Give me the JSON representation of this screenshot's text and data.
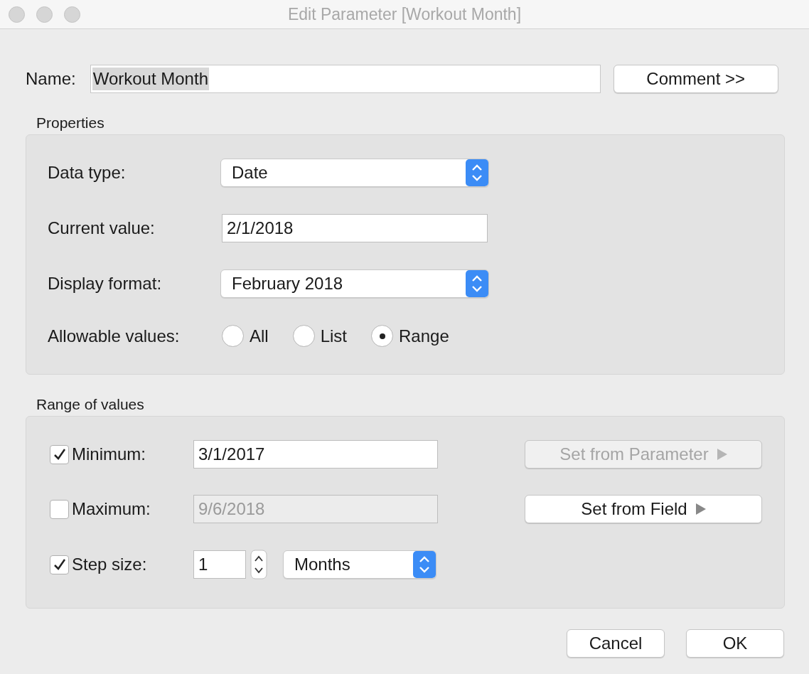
{
  "window": {
    "title": "Edit Parameter [Workout Month]"
  },
  "name": {
    "label": "Name:",
    "value": "Workout Month",
    "selected": true
  },
  "comment_button": {
    "label": "Comment >>"
  },
  "properties": {
    "title": "Properties",
    "data_type": {
      "label": "Data type:",
      "value": "Date"
    },
    "current_value": {
      "label": "Current value:",
      "value": "2/1/2018"
    },
    "display_format": {
      "label": "Display format:",
      "value": "February 2018"
    },
    "allowable_values": {
      "label": "Allowable values:",
      "options": [
        {
          "label": "All",
          "selected": false
        },
        {
          "label": "List",
          "selected": false
        },
        {
          "label": "Range",
          "selected": true
        }
      ]
    }
  },
  "range": {
    "title": "Range of values",
    "rows": [
      {
        "kind": "field",
        "label": "Minimum:",
        "checked": true,
        "value": "3/1/2017",
        "disabled": false,
        "button": {
          "label": "Set from Parameter",
          "disabled": true
        }
      },
      {
        "kind": "field",
        "label": "Maximum:",
        "checked": false,
        "value": "9/6/2018",
        "disabled": true,
        "button": {
          "label": "Set from Field",
          "disabled": false
        }
      },
      {
        "kind": "step",
        "label": "Step size:",
        "checked": true,
        "value": "1",
        "unit": "Months"
      }
    ]
  },
  "buttons": [
    {
      "label": "Cancel"
    },
    {
      "label": "OK"
    }
  ]
}
